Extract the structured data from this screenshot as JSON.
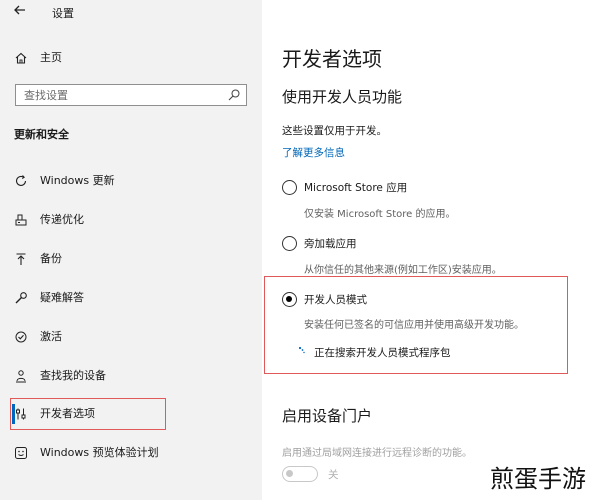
{
  "window": {
    "title": "设置"
  },
  "sidebar": {
    "home_label": "主页",
    "search_placeholder": "查找设置",
    "section_header": "更新和安全",
    "items": [
      {
        "label": "Windows 更新",
        "icon": "refresh-icon"
      },
      {
        "label": "传递优化",
        "icon": "delivery-optimization-icon"
      },
      {
        "label": "备份",
        "icon": "backup-arrow-icon"
      },
      {
        "label": "疑难解答",
        "icon": "wrench-icon"
      },
      {
        "label": "激活",
        "icon": "activation-check-icon"
      },
      {
        "label": "查找我的设备",
        "icon": "person-pin-icon"
      },
      {
        "label": "开发者选项",
        "icon": "developer-sliders-icon",
        "selected": true
      },
      {
        "label": "Windows 预览体验计划",
        "icon": "insider-smiley-icon"
      }
    ]
  },
  "main": {
    "title": "开发者选项",
    "subtitle": "使用开发人员功能",
    "description": "这些设置仅用于开发。",
    "link": "了解更多信息",
    "options": [
      {
        "label": "Microsoft Store 应用",
        "description": "仅安装 Microsoft Store 的应用。",
        "checked": false
      },
      {
        "label": "旁加载应用",
        "description": "从你信任的其他来源(例如工作区)安装应用。",
        "checked": false
      },
      {
        "label": "开发人员模式",
        "description": "安装任何已签名的可信应用并使用高级开发功能。",
        "checked": true
      }
    ],
    "searching_status": "正在搜索开发人员模式程序包",
    "device_portal": {
      "title": "启用设备门户",
      "description": "启用通过局域网连接进行远程诊断的功能。",
      "toggle_label": "关",
      "toggle_on": false
    }
  },
  "watermark": "煎蛋手游",
  "colors": {
    "sidebar_bg": "#f2f2f2",
    "accent": "#0067c0",
    "link": "#0067b8",
    "highlight_border": "#e05a5a"
  }
}
